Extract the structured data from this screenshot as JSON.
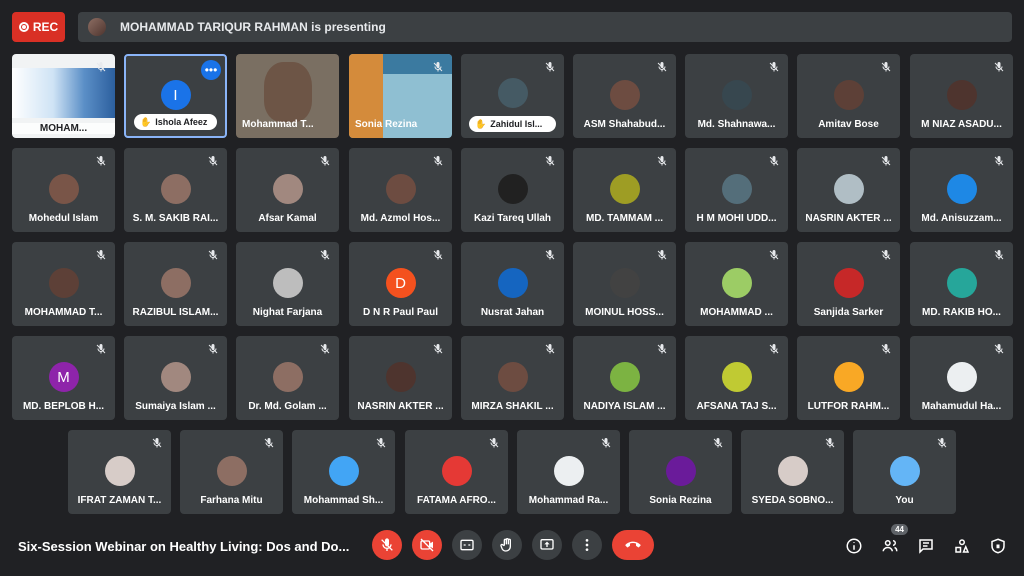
{
  "top": {
    "rec_label": "REC",
    "presenter_text": "MOHAMMAD TARIQUR RAHMAN is presenting"
  },
  "tiles": [
    {
      "name": "MOHAM...",
      "type": "screen"
    },
    {
      "name": "Ishola Afeez",
      "type": "selected",
      "initial": "I",
      "color": "#1a73e8"
    },
    {
      "name": "Mohammad T...",
      "type": "video"
    },
    {
      "name": "Sonia Rezina",
      "type": "slide"
    },
    {
      "name": "Zahidul Isl...",
      "type": "hand",
      "color": "#455a64"
    },
    {
      "name": "ASM Shahabud...",
      "color": "#6d4c41"
    },
    {
      "name": "Md. Shahnawa...",
      "color": "#37474f"
    },
    {
      "name": "Amitav Bose",
      "color": "#5d4037"
    },
    {
      "name": "M NIAZ ASADU...",
      "color": "#4e342e"
    },
    {
      "name": "Mohedul Islam",
      "color": "#795548"
    },
    {
      "name": "S. M. SAKIB RAI...",
      "color": "#8d6e63"
    },
    {
      "name": "Afsar Kamal",
      "color": "#a1887f"
    },
    {
      "name": "Md. Azmol Hos...",
      "color": "#6d4c41"
    },
    {
      "name": "Kazi Tareq Ullah",
      "color": "#212121"
    },
    {
      "name": "MD. TAMMAM ...",
      "color": "#9e9d24"
    },
    {
      "name": "H M MOHI UDD...",
      "color": "#546e7a"
    },
    {
      "name": "NASRIN AKTER ...",
      "color": "#b0bec5"
    },
    {
      "name": "Md. Anisuzzam...",
      "color": "#1e88e5"
    },
    {
      "name": "MOHAMMAD T...",
      "color": "#5d4037"
    },
    {
      "name": "RAZIBUL ISLAM...",
      "color": "#8d6e63"
    },
    {
      "name": "Nighat Farjana",
      "color": "#bdbdbd"
    },
    {
      "name": "D N R Paul Paul",
      "initial": "D",
      "color": "#f4511e"
    },
    {
      "name": "Nusrat Jahan",
      "color": "#1565c0"
    },
    {
      "name": "MOINUL HOSS...",
      "color": "#424242"
    },
    {
      "name": "MOHAMMAD ...",
      "color": "#9ccc65"
    },
    {
      "name": "Sanjida Sarker",
      "color": "#c62828"
    },
    {
      "name": "MD. RAKIB HO...",
      "color": "#26a69a"
    },
    {
      "name": "MD. BEPLOB H...",
      "initial": "M",
      "color": "#8e24aa"
    },
    {
      "name": "Sumaiya Islam ...",
      "color": "#a1887f"
    },
    {
      "name": "Dr. Md. Golam ...",
      "color": "#8d6e63"
    },
    {
      "name": "NASRIN AKTER ...",
      "color": "#4e342e"
    },
    {
      "name": "MIRZA SHAKIL ...",
      "color": "#6d4c41"
    },
    {
      "name": "NADIYA ISLAM ...",
      "color": "#7cb342"
    },
    {
      "name": "AFSANA TAJ S...",
      "color": "#c0ca33"
    },
    {
      "name": "LUTFOR RAHM...",
      "color": "#f9a825"
    },
    {
      "name": "Mahamudul Ha...",
      "color": "#eceff1"
    },
    {
      "name": "IFRAT ZAMAN T...",
      "color": "#d7ccc8"
    },
    {
      "name": "Farhana Mitu",
      "color": "#8d6e63"
    },
    {
      "name": "Mohammad Sh...",
      "color": "#42a5f5"
    },
    {
      "name": "FATAMA AFRO...",
      "color": "#e53935"
    },
    {
      "name": "Mohammad Ra...",
      "color": "#eceff1"
    },
    {
      "name": "Sonia Rezina",
      "color": "#6a1b9a"
    },
    {
      "name": "SYEDA SOBNO...",
      "color": "#d7ccc8"
    },
    {
      "name": "You",
      "color": "#64b5f6"
    }
  ],
  "bottom": {
    "meeting_title": "Six-Session Webinar on Healthy Living: Dos and Do...",
    "participants_count": "44"
  }
}
